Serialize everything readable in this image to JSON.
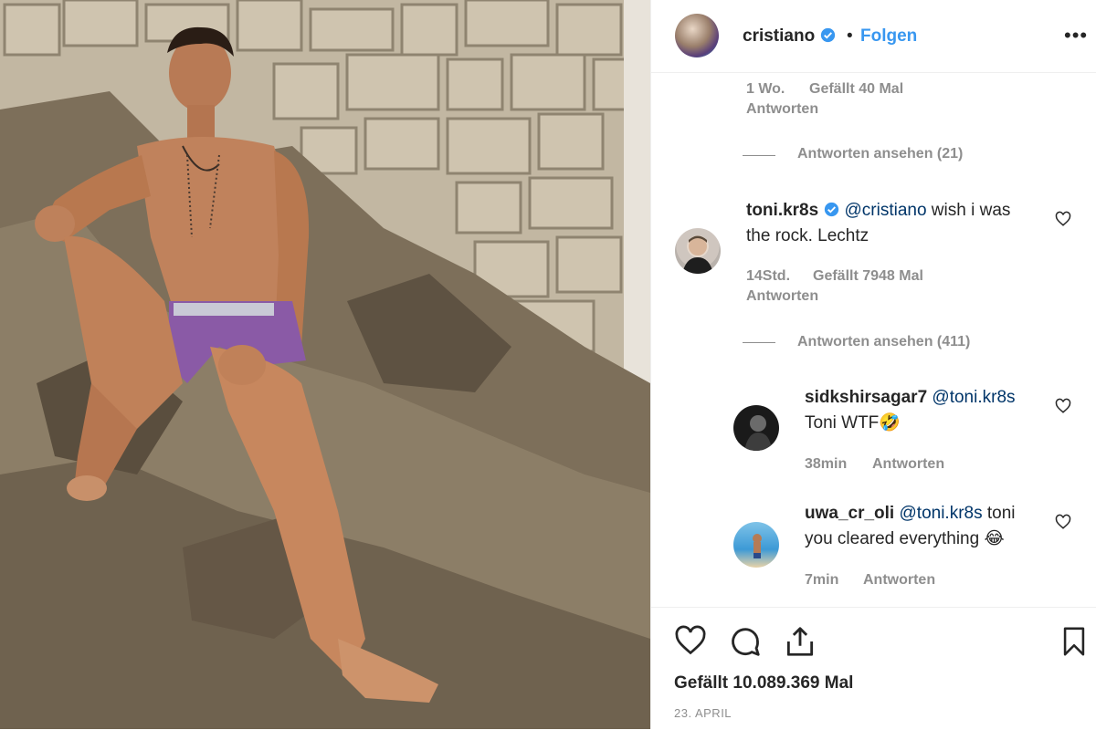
{
  "post": {
    "username": "cristiano",
    "follow_label": "Folgen",
    "separator": "•",
    "more_label": "•••"
  },
  "partial_comment": {
    "time": "1 Wo.",
    "likes": "Gefällt 40 Mal",
    "reply": "Antworten",
    "view_replies": "Antworten ansehen (21)"
  },
  "comments": [
    {
      "username": "toni.kr8s",
      "mention": "@cristiano",
      "text_line1": " wish i was",
      "text_line2": "the rock. Lechtz",
      "time": "14Std.",
      "likes": "Gefällt 7948 Mal",
      "reply": "Antworten",
      "view_replies": "Antworten ansehen (411)"
    }
  ],
  "replies": [
    {
      "username": "sidkshirsagar7",
      "mention": "@toni.kr8s",
      "text_line2": "Toni WTF🤣",
      "time": "38min",
      "reply": "Antworten"
    },
    {
      "username": "uwa_cr_oli",
      "mention": "@toni.kr8s",
      "text_line1": " toni",
      "text_line2": "you cleared everything 😂",
      "time": "7min",
      "reply": "Antworten"
    }
  ],
  "footer": {
    "likes": "Gefällt 10.089.369 Mal",
    "date": "23. APRIL"
  },
  "icons": [
    "heart-icon",
    "comment-icon",
    "share-icon",
    "bookmark-icon",
    "verified-icon",
    "more-icon"
  ],
  "colors": {
    "link": "#3897f0",
    "verified": "#3897f0",
    "muted": "#8e8e8e",
    "mention": "#003569"
  }
}
